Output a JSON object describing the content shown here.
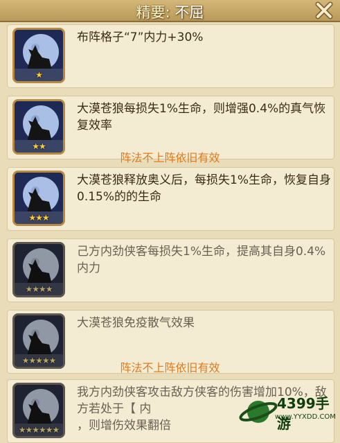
{
  "header": {
    "title_main": "精要:",
    "title_sub": "不屈"
  },
  "skills": [
    {
      "stars": "★",
      "description": "布阵格子“7”内力+30%",
      "locked": false
    },
    {
      "stars": "★★",
      "description": "大漠苍狼每损失1%生命，则增强0.4%的真气恢复效率",
      "locked": false
    },
    {
      "stars": "★★★",
      "description": "大漠苍狼释放奥义后，每损失1%生命，恢复自身0.15%的的生命",
      "locked": false
    },
    {
      "stars": "★★★★",
      "description": "己方内劲侠客每损失1%生命，提高其自身0.4%内力",
      "locked": true
    },
    {
      "stars": "★★★★★",
      "description": "大漠苍狼免疫散气效果",
      "locked": true
    },
    {
      "stars": "★★★★★★",
      "description": "我方内劲侠客攻击敌方侠客的伤害增加10%，敌方若处于【 内",
      "description2": "，则增伤效果翻倍",
      "locked": true
    }
  ],
  "notes": {
    "note1": "阵法不上阵依旧有效",
    "note2": "阵法不上阵依旧有效"
  },
  "watermark": {
    "text": "4399手游",
    "url": "www.YYXDD.COM"
  },
  "icons": {
    "close": "close-icon",
    "skill": "wolf-moon-icon"
  },
  "colors": {
    "note": "#e07a1c",
    "title_bar": "#c9a96a"
  }
}
